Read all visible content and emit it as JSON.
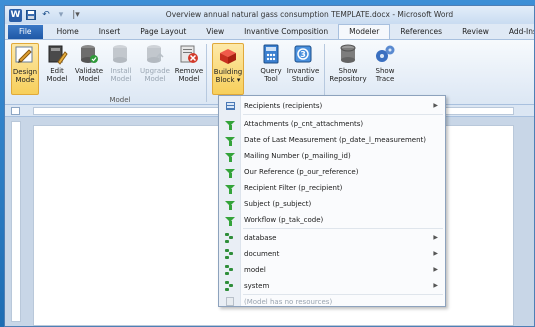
{
  "window": {
    "title": "Overview annual natural gass consumption TEMPLATE.docx  -  Microsoft Word",
    "app_logo": "W"
  },
  "tabs": [
    {
      "label": "File"
    },
    {
      "label": "Home"
    },
    {
      "label": "Insert"
    },
    {
      "label": "Page Layout"
    },
    {
      "label": "View"
    },
    {
      "label": "Invantive Composition"
    },
    {
      "label": "Modeler"
    },
    {
      "label": "References"
    },
    {
      "label": "Review"
    },
    {
      "label": "Add-Ins"
    }
  ],
  "ribbon": {
    "buttons": [
      {
        "label1": "Design",
        "label2": "Mode",
        "icon": "design-mode-icon",
        "state": "active"
      },
      {
        "label1": "Edit",
        "label2": "Model",
        "icon": "edit-model-icon",
        "state": "normal"
      },
      {
        "label1": "Validate",
        "label2": "Model",
        "icon": "validate-model-icon",
        "state": "normal"
      },
      {
        "label1": "Install",
        "label2": "Model",
        "icon": "install-model-icon",
        "state": "disabled"
      },
      {
        "label1": "Upgrade",
        "label2": "Model",
        "icon": "upgrade-model-icon",
        "state": "disabled"
      },
      {
        "label1": "Remove",
        "label2": "Model",
        "icon": "remove-model-icon",
        "state": "normal"
      },
      {
        "label1": "Building",
        "label2": "Block ▾",
        "icon": "building-block-icon",
        "state": "highlight"
      },
      {
        "label1": "Query",
        "label2": "Tool",
        "icon": "query-tool-icon",
        "state": "normal"
      },
      {
        "label1": "Invantive",
        "label2": "Studio",
        "icon": "invantive-studio-icon",
        "state": "normal"
      },
      {
        "label1": "Show",
        "label2": "Repository",
        "icon": "show-repository-icon",
        "state": "normal"
      },
      {
        "label1": "Show",
        "label2": "Trace",
        "icon": "show-trace-icon",
        "state": "normal"
      }
    ],
    "group_label": "Model"
  },
  "menu": {
    "items": [
      {
        "label": "Recipients (recipients)",
        "icon": "table-icon",
        "submenu": true
      },
      {
        "label": "Attachments (p_cnt_attachments)",
        "icon": "filter-icon",
        "submenu": false
      },
      {
        "label": "Date of Last Measurement (p_date_l_measurement)",
        "icon": "filter-icon",
        "submenu": false
      },
      {
        "label": "Mailing Number (p_mailing_id)",
        "icon": "filter-icon",
        "submenu": false
      },
      {
        "label": "Our Reference (p_our_reference)",
        "icon": "filter-icon",
        "submenu": false
      },
      {
        "label": "Recipient Filter (p_recipient)",
        "icon": "filter-icon",
        "submenu": false
      },
      {
        "label": "Subject (p_subject)",
        "icon": "filter-icon",
        "submenu": false
      },
      {
        "label": "Workflow (p_tak_code)",
        "icon": "filter-icon",
        "submenu": false
      },
      {
        "label": "database",
        "icon": "tree-icon",
        "submenu": true
      },
      {
        "label": "document",
        "icon": "tree-icon",
        "submenu": true
      },
      {
        "label": "model",
        "icon": "tree-icon",
        "submenu": true
      },
      {
        "label": "system",
        "icon": "tree-icon",
        "submenu": true
      },
      {
        "label": "(Model has no resources)",
        "icon": "resource-icon",
        "submenu": false,
        "disabled": true
      }
    ]
  },
  "colors": {
    "ribbon_accent": "#f7cf5b",
    "filter_green": "#34a33a",
    "file_tab": "#2a66b4"
  }
}
